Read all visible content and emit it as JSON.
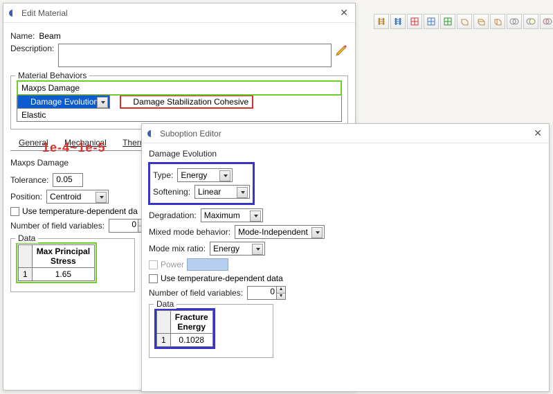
{
  "editMaterial": {
    "title": "Edit Material",
    "nameLabel": "Name:",
    "nameValue": "Beam",
    "descLabel": "Description:",
    "descValue": "",
    "behaviorsTitle": "Material Behaviors",
    "behaviors": {
      "maxps": "Maxps Damage",
      "damageEvolution": "Damage Evolution",
      "damageStabCohesive": "Damage Stabilization Cohesive",
      "elastic": "Elastic"
    },
    "tabs": {
      "general": "General",
      "mechanical": "Mechanical",
      "thermal": "Thermal"
    },
    "maxpsSection": "Maxps Damage",
    "toleranceLabel": "Tolerance:",
    "toleranceValue": "0.05",
    "positionLabel": "Position:",
    "positionValue": "Centroid",
    "useTempLabel": "Use temperature-dependent da",
    "numFieldVarsLabel": "Number of field variables:",
    "numFieldVarsValue": "0",
    "dataTitle": "Data",
    "dataHeader": "Max Principal\nStress",
    "dataRowNum": "1",
    "dataValue": "1.65"
  },
  "annotation": "1e-4~1e-5",
  "subopt": {
    "title": "Suboption Editor",
    "header": "Damage Evolution",
    "typeLabel": "Type:",
    "typeValue": "Energy",
    "softeningLabel": "Softening:",
    "softeningValue": "Linear",
    "degradationLabel": "Degradation:",
    "degradationValue": "Maximum",
    "mixedModeLabel": "Mixed mode behavior:",
    "mixedModeValue": "Mode-Independent",
    "modeMixRatioLabel": "Mode mix ratio:",
    "modeMixRatioValue": "Energy",
    "powerLabel": "Power",
    "useTempLabel": "Use temperature-dependent data",
    "numFieldVarsLabel": "Number of field variables:",
    "numFieldVarsValue": "0",
    "dataTitle": "Data",
    "dataHeader": "Fracture\nEnergy",
    "dataRowNum": "1",
    "dataValue": "0.1028"
  }
}
